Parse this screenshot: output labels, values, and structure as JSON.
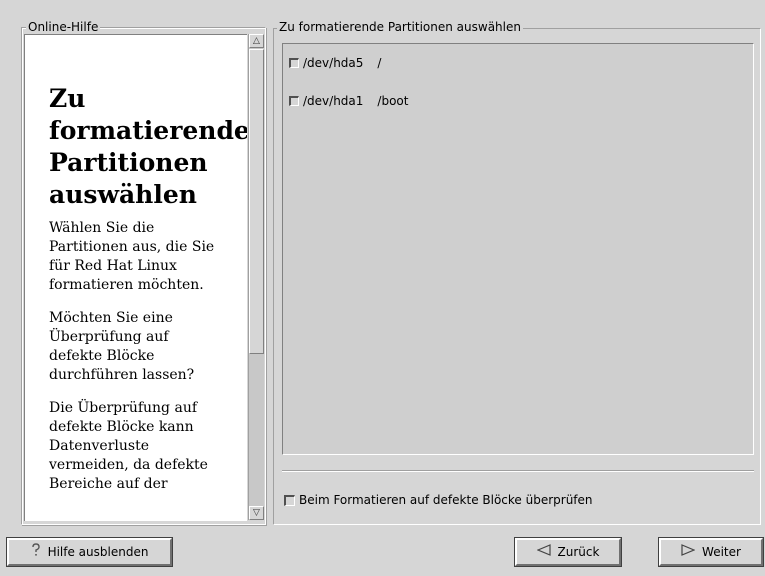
{
  "help": {
    "frame_label": "Online-Hilfe",
    "title": "Zu formatierende Partitionen auswählen",
    "paragraphs": [
      "Wählen Sie die Partitionen aus, die Sie für Red Hat Linux formatieren möchten.",
      "Möchten Sie eine Überprüfung auf defekte Blöcke durchführen lassen?",
      "Die Überprüfung auf defekte Blöcke kann Datenverluste vermeiden, da defekte Bereiche auf der"
    ]
  },
  "partitions": {
    "frame_label": "Zu formatierende Partitionen auswählen",
    "items": [
      {
        "device": "/dev/hda5",
        "mount": "/",
        "checked": false
      },
      {
        "device": "/dev/hda1",
        "mount": "/boot",
        "checked": false
      }
    ],
    "badblocks_label": "Beim Formatieren auf defekte Blöcke überprüfen",
    "badblocks_checked": false
  },
  "buttons": {
    "hide_help": "Hilfe ausblenden",
    "back": "Zurück",
    "next": "Weiter"
  },
  "icons": {
    "hide_help": "help-icon",
    "back": "arrow-left-icon",
    "next": "arrow-right-icon",
    "scroll_up": "scroll-up-icon",
    "scroll_down": "scroll-down-icon"
  }
}
